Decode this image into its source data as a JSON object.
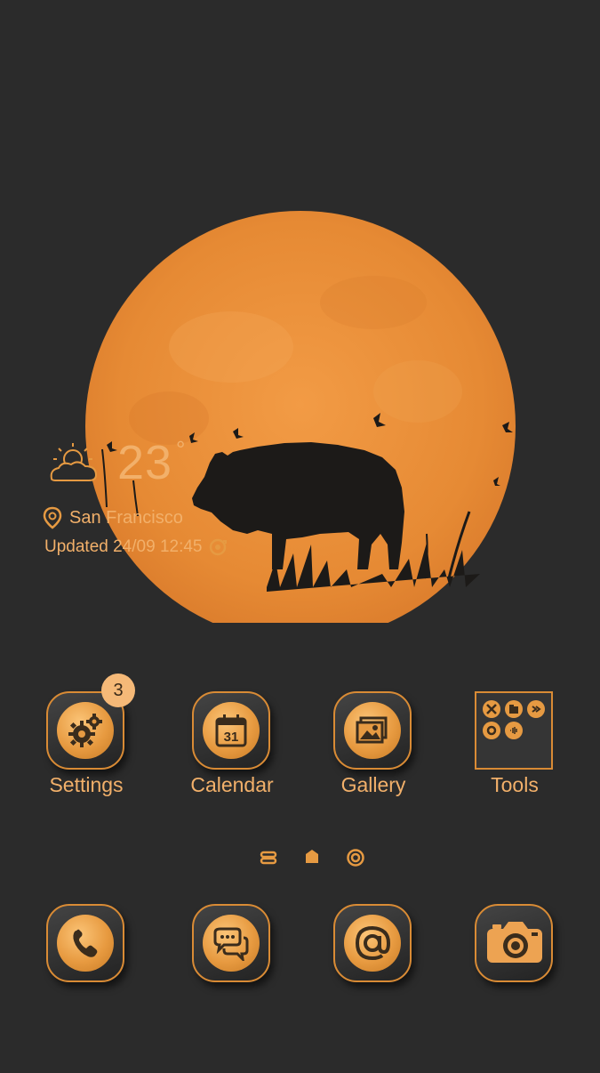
{
  "weather": {
    "temperature": "23",
    "degree_symbol": "°",
    "location": "San Francisco",
    "updated": "Updated 24/09 12:45"
  },
  "apps": [
    {
      "label": "Settings",
      "badge": "3",
      "icon": "gears-icon"
    },
    {
      "label": "Calendar",
      "icon": "calendar-icon",
      "calendar_day": "31"
    },
    {
      "label": "Gallery",
      "icon": "image-icon"
    },
    {
      "label": "Tools",
      "icon": "folder-icon"
    }
  ],
  "dock": [
    {
      "icon": "phone-icon"
    },
    {
      "icon": "messages-icon"
    },
    {
      "icon": "email-icon"
    },
    {
      "icon": "camera-icon"
    }
  ],
  "colors": {
    "background": "#2b2b2b",
    "accent": "#e69a42",
    "text": "#f2b06a",
    "moon": "#e8913a"
  }
}
